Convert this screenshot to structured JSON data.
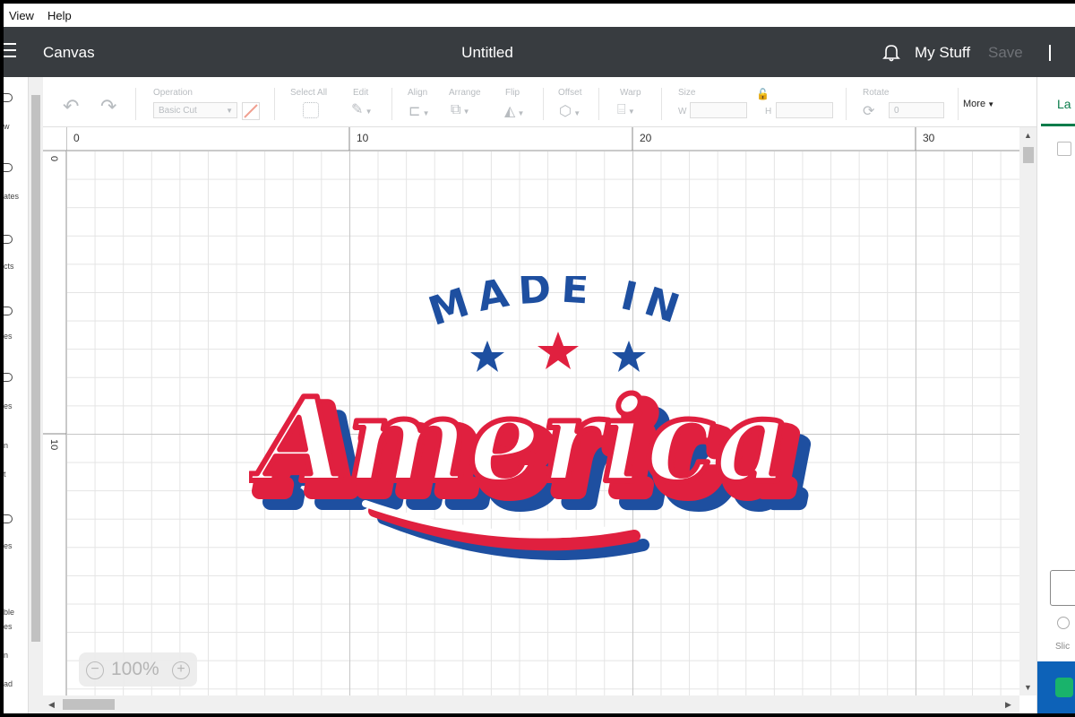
{
  "menubar": {
    "view": "View",
    "help": "Help"
  },
  "header": {
    "app_title": "Canvas",
    "doc_title": "Untitled",
    "my_stuff": "My Stuff",
    "save": "Save"
  },
  "leftbar": {
    "items": [
      "w",
      "ates",
      "cts",
      "es",
      "es",
      "n",
      "t",
      "es",
      "ble",
      "es",
      "n",
      "ad"
    ]
  },
  "toolbar": {
    "operation_label": "Operation",
    "operation_value": "Basic Cut",
    "select_all": "Select All",
    "edit": "Edit",
    "align": "Align",
    "arrange": "Arrange",
    "flip": "Flip",
    "offset": "Offset",
    "warp": "Warp",
    "size": "Size",
    "w": "W",
    "h": "H",
    "rotate": "Rotate",
    "rotate_value": "0",
    "more": "More"
  },
  "right_panel": {
    "layers_tab": "La",
    "slice": "Slic"
  },
  "rulers": {
    "top": [
      "0",
      "10",
      "20",
      "30"
    ],
    "left": [
      "0",
      "10"
    ]
  },
  "design": {
    "line1": "MADE IN",
    "line2": "America",
    "colors": {
      "blue": "#1e4fa0",
      "red": "#e0203f",
      "white": "#ffffff"
    }
  },
  "zoom": {
    "value": "100%"
  }
}
